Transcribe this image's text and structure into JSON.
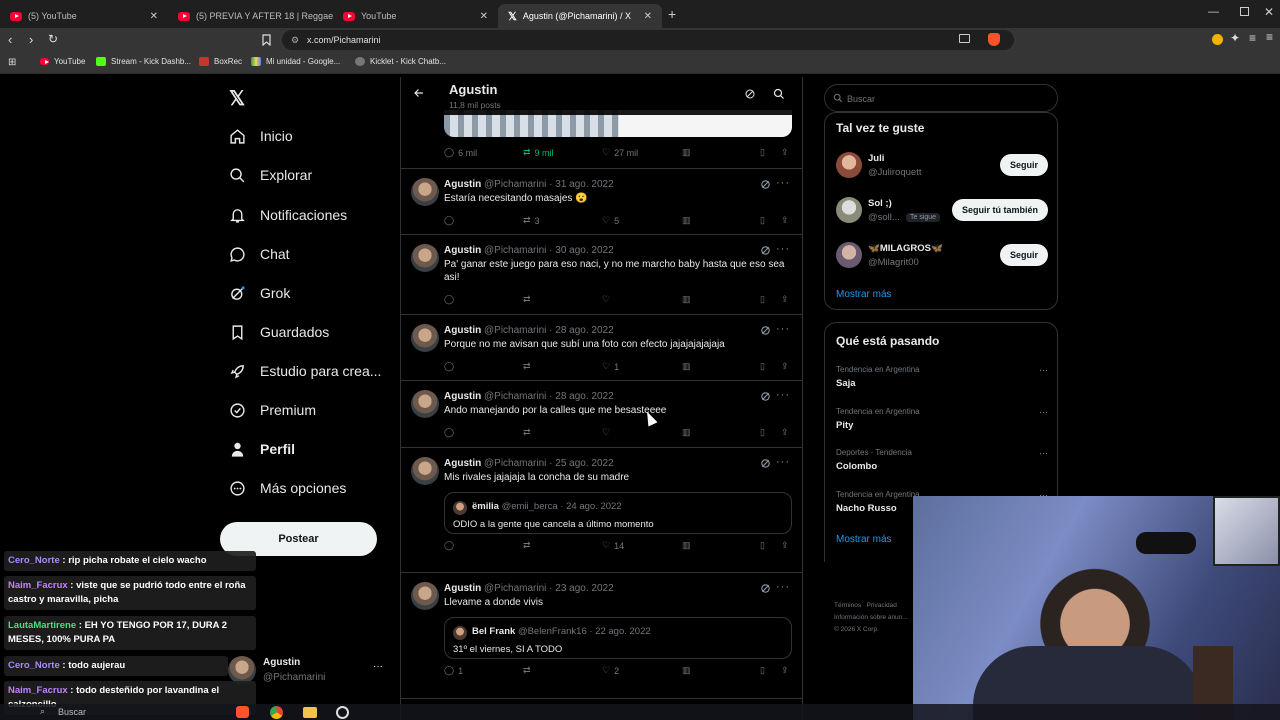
{
  "browser": {
    "tabs": [
      {
        "label": "(5) YouTube",
        "icon": "youtube-icon"
      },
      {
        "label": "(5) PREVIA Y AFTER 18 | Reggaeton",
        "icon": "youtube-icon"
      },
      {
        "label": "YouTube",
        "icon": "youtube-icon"
      },
      {
        "label": "Agustin (@Pichamarini) / X",
        "icon": "x-icon"
      }
    ],
    "url": "x.com/Pichamarini",
    "bookmarks": [
      "YouTube",
      "Stream - Kick Dashb...",
      "BoxRec",
      "Mi unidad - Google...",
      "Kicklet - Kick Chatb..."
    ]
  },
  "nav": {
    "items": [
      {
        "label": "Inicio",
        "icon": "home-icon"
      },
      {
        "label": "Explorar",
        "icon": "search-icon"
      },
      {
        "label": "Notificaciones",
        "icon": "bell-icon"
      },
      {
        "label": "Chat",
        "icon": "chat-icon"
      },
      {
        "label": "Grok",
        "icon": "grok-icon"
      },
      {
        "label": "Guardados",
        "icon": "bookmark-icon"
      },
      {
        "label": "Estudio para crea...",
        "icon": "rocket-icon"
      },
      {
        "label": "Premium",
        "icon": "verified-icon"
      },
      {
        "label": "Perfil",
        "icon": "person-icon"
      },
      {
        "label": "Más opciones",
        "icon": "more-circle-icon"
      }
    ],
    "post_label": "Postear",
    "account": {
      "name": "Agustin",
      "handle": "@Pichamarini",
      "more": "···"
    }
  },
  "header": {
    "title": "Agustin",
    "subtitle": "11,8 mil posts"
  },
  "first_actions": {
    "replies": "6 mil",
    "reposts": "9 mil",
    "likes": "27 mil"
  },
  "tweets": [
    {
      "name": "Agustin",
      "meta": "@Pichamarini · 31 ago. 2022",
      "text": "Estaría necesitando masajes 😮",
      "replies": "",
      "reposts": "3",
      "likes": "5"
    },
    {
      "name": "Agustin",
      "meta": "@Pichamarini · 30 ago. 2022",
      "text": "Pa' ganar este juego para eso naci, y no me marcho baby hasta que eso sea asi!",
      "replies": "",
      "reposts": "",
      "likes": ""
    },
    {
      "name": "Agustin",
      "meta": "@Pichamarini · 28 ago. 2022",
      "text": "Porque no me avisan que subí una foto con efecto jajajajajajaja",
      "replies": "",
      "reposts": "",
      "likes": "1"
    },
    {
      "name": "Agustin",
      "meta": "@Pichamarini · 28 ago. 2022",
      "text": "Ando manejando por la calles que me besasteeee",
      "replies": "",
      "reposts": "",
      "likes": ""
    },
    {
      "name": "Agustin",
      "meta": "@Pichamarini · 25 ago. 2022",
      "text": "Mis rivales jajajaja la concha de su madre",
      "replies": "",
      "reposts": "",
      "likes": "14",
      "quote": {
        "name": "ëmilia",
        "meta": "@emii_berca · 24 ago. 2022",
        "text": "ODIO a la gente que cancela a último momento"
      }
    },
    {
      "name": "Agustin",
      "meta": "@Pichamarini · 23 ago. 2022",
      "text": "Llevame a donde vivis",
      "replies": "1",
      "reposts": "",
      "likes": "2",
      "quote": {
        "name": "Bel Frank",
        "meta": "@BelenFrank16 · 22 ago. 2022",
        "text": "31º el viernes, SI A TODO"
      }
    }
  ],
  "right": {
    "search_placeholder": "Buscar",
    "suggest_title": "Tal vez te guste",
    "suggestions": [
      {
        "name": "Juli",
        "handle": "@Juliroquett",
        "button": "Seguir",
        "badge": ""
      },
      {
        "name": "Sol ;)",
        "handle": "@soll...",
        "button": "Seguir tú también",
        "badge": "Te sigue"
      },
      {
        "name": "🦋MILAGROS🦋",
        "handle": "@Milagrit00",
        "button": "Seguir",
        "badge": ""
      }
    ],
    "show_more": "Mostrar más",
    "trends_title": "Qué está pasando",
    "trends": [
      {
        "context": "Tendencia en Argentina",
        "name": "Saja"
      },
      {
        "context": "Tendencia en Argentina",
        "name": "Pity"
      },
      {
        "context": "Deportes · Tendencia",
        "name": "Colombo"
      },
      {
        "context": "Tendencia en Argentina",
        "name": "Nacho Russo"
      }
    ],
    "trends_show_more": "Mostrar más",
    "footer": [
      "Términos",
      "Privacidad",
      "Información sobre anun...",
      "© 2026 X Corp."
    ]
  },
  "chat_overlay": [
    {
      "user": "Cero_Norte",
      "color": "#a78bfa",
      "msg": "rip picha robate el cielo wacho"
    },
    {
      "user": "Naim_Facrux",
      "color": "#c084fc",
      "msg": "viste que se pudrió todo entre el roña castro y maravilla, picha"
    },
    {
      "user": "LautaMartirene",
      "color": "#4ade80",
      "msg": "EH YO TENGO POR 17, DURA 2 MESES, 100% PURA PA"
    },
    {
      "user": "Cero_Norte",
      "color": "#a78bfa",
      "msg": "todo aujerau"
    },
    {
      "user": "Naim_Facrux",
      "color": "#c084fc",
      "msg": "todo desteñido por lavandina el calzoncillo"
    }
  ],
  "taskbar": {
    "search_placeholder": "Buscar"
  }
}
